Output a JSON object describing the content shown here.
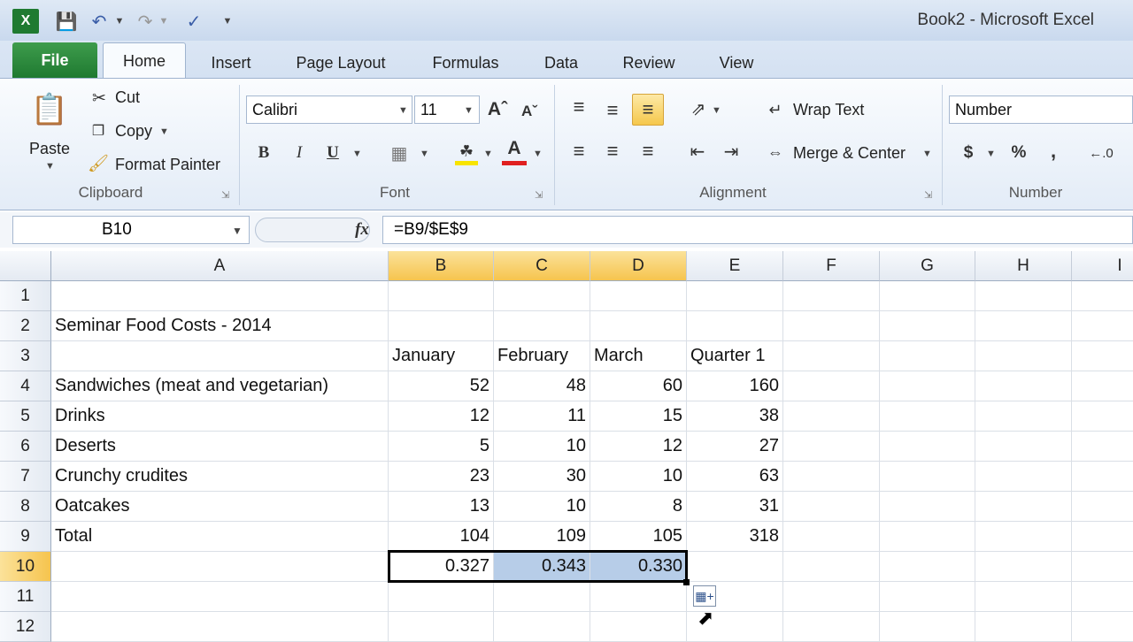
{
  "window": {
    "title": "Book2 - Microsoft Excel"
  },
  "tabs": [
    "File",
    "Home",
    "Insert",
    "Page Layout",
    "Formulas",
    "Data",
    "Review",
    "View"
  ],
  "clipboard": {
    "paste": "Paste",
    "cut": "Cut",
    "copy": "Copy",
    "format_painter": "Format Painter",
    "label": "Clipboard"
  },
  "font": {
    "name": "Calibri",
    "size": "11",
    "bold": "B",
    "italic": "I",
    "underline": "U",
    "color_letter": "A",
    "label": "Font",
    "accent_fill": "#f8e400",
    "accent_font": "#e02020"
  },
  "alignment": {
    "wrap": "Wrap Text",
    "merge": "Merge & Center",
    "label": "Alignment"
  },
  "number": {
    "format": "Number",
    "currency": "$",
    "percent": "%",
    "comma": ",",
    "label": "Number"
  },
  "formula_bar": {
    "name_box": "B10",
    "fx": "fx",
    "formula": "=B9/$E$9"
  },
  "grid": {
    "columns": [
      "A",
      "B",
      "C",
      "D",
      "E",
      "F",
      "G",
      "H",
      "I"
    ],
    "rows": [
      "1",
      "2",
      "3",
      "4",
      "5",
      "6",
      "7",
      "8",
      "9",
      "10",
      "11",
      "12"
    ],
    "cells": {
      "A2": "Seminar Food Costs - 2014",
      "B3": "January",
      "C3": "February",
      "D3": "March",
      "E3": "Quarter 1",
      "A4": "Sandwiches (meat and vegetarian)",
      "B4": "52",
      "C4": "48",
      "D4": "60",
      "E4": "160",
      "A5": "Drinks",
      "B5": "12",
      "C5": "11",
      "D5": "15",
      "E5": "38",
      "A6": "Deserts",
      "B6": "5",
      "C6": "10",
      "D6": "12",
      "E6": "27",
      "A7": "Crunchy crudites",
      "B7": "23",
      "C7": "30",
      "D7": "10",
      "E7": "63",
      "A8": "Oatcakes",
      "B8": "13",
      "C8": "10",
      "D8": "8",
      "E8": "31",
      "A9": "Total",
      "B9": "104",
      "C9": "109",
      "D9": "105",
      "E9": "318",
      "B10": "0.327",
      "C10": "0.343",
      "D10": "0.330"
    }
  }
}
